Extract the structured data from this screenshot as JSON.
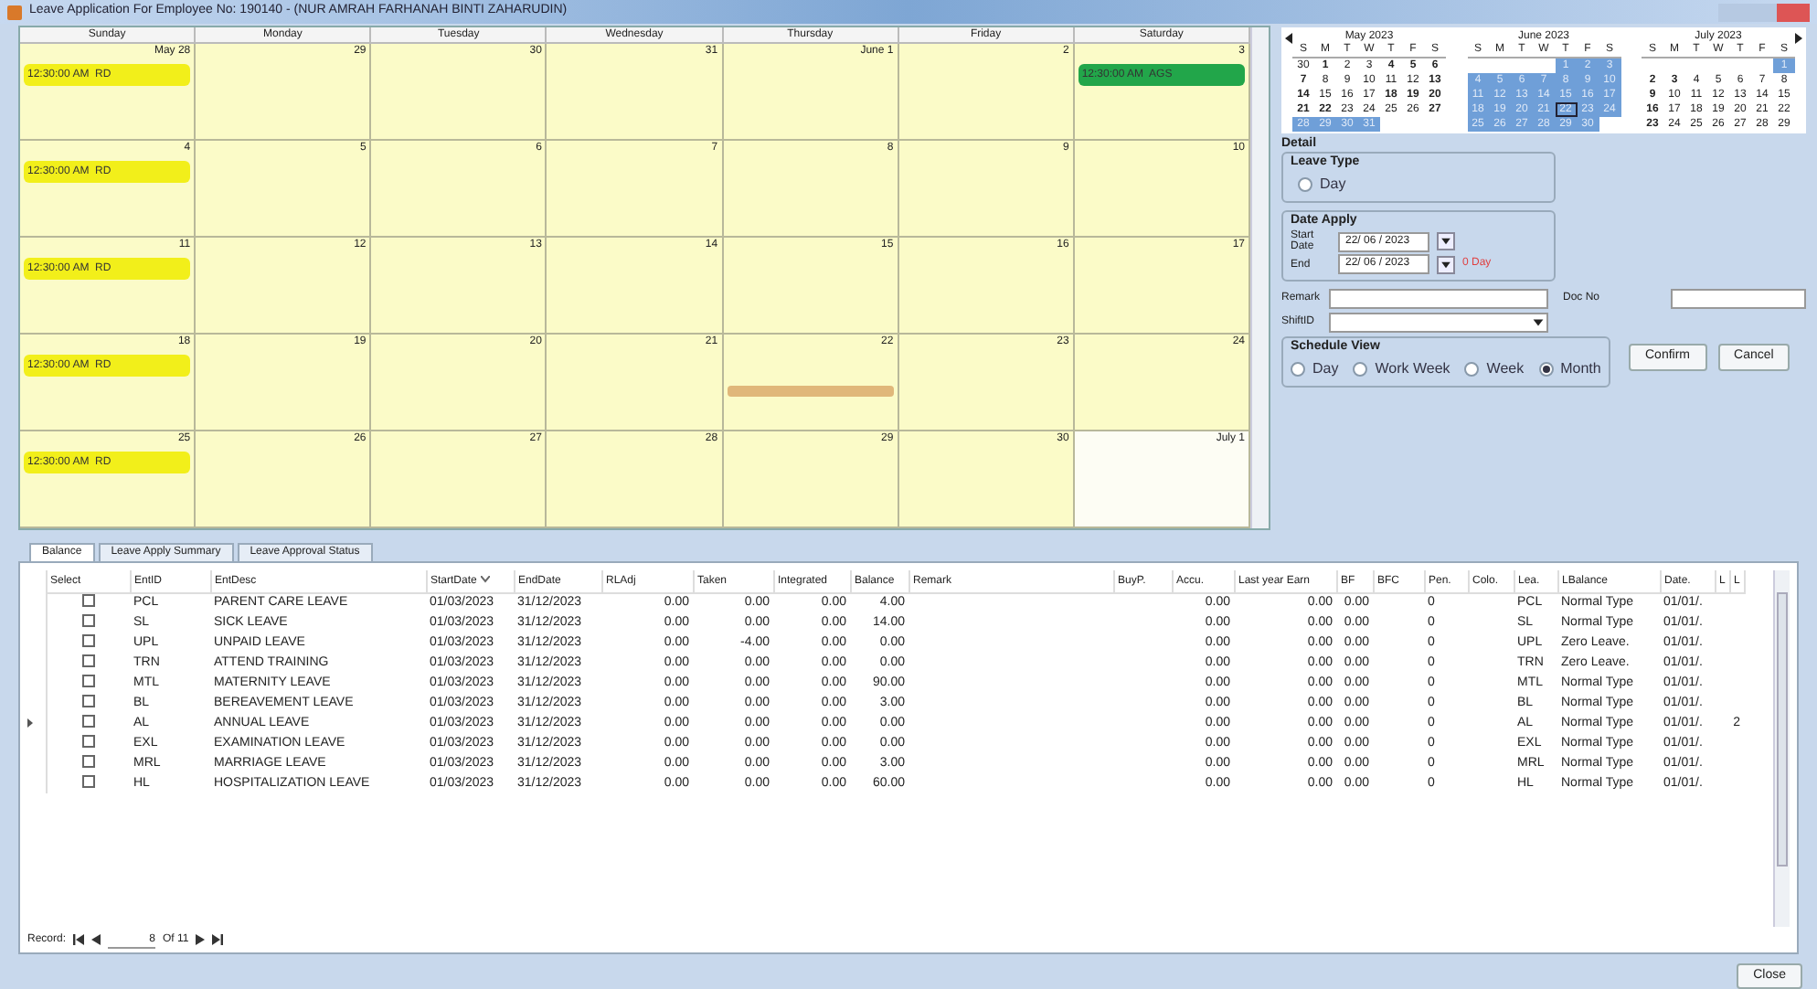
{
  "window": {
    "title": "Leave Application For Employee No: 190140 - (NUR AMRAH FARHANAH BINTI ZAHARUDIN)"
  },
  "schedule": {
    "weekdays": [
      "Sunday",
      "Monday",
      "Tuesday",
      "Wednesday",
      "Thursday",
      "Friday",
      "Saturday"
    ],
    "days": [
      {
        "label": "May 28",
        "shaded": true,
        "selected": false,
        "events": [
          {
            "text": "12:30:00 AM  RD",
            "color": "#f2ef1a"
          }
        ]
      },
      {
        "label": "29",
        "shaded": true,
        "selected": false
      },
      {
        "label": "30",
        "shaded": true,
        "selected": false
      },
      {
        "label": "31",
        "shaded": true,
        "selected": false
      },
      {
        "label": "June 1",
        "shaded": true,
        "selected": false
      },
      {
        "label": "2",
        "shaded": true,
        "selected": false
      },
      {
        "label": "3",
        "shaded": true,
        "selected": false,
        "events": [
          {
            "text": "12:30:00 AM  AGS",
            "color": "#22a64a"
          }
        ]
      },
      {
        "label": "4",
        "shaded": true,
        "selected": false,
        "events": [
          {
            "text": "12:30:00 AM  RD",
            "color": "#f2ef1a"
          }
        ]
      },
      {
        "label": "5",
        "shaded": true,
        "selected": false
      },
      {
        "label": "6",
        "shaded": true,
        "selected": false
      },
      {
        "label": "7",
        "shaded": true,
        "selected": false
      },
      {
        "label": "8",
        "shaded": true,
        "selected": false
      },
      {
        "label": "9",
        "shaded": true,
        "selected": false
      },
      {
        "label": "10",
        "shaded": true,
        "selected": false
      },
      {
        "label": "11",
        "shaded": true,
        "selected": false,
        "events": [
          {
            "text": "12:30:00 AM  RD",
            "color": "#f2ef1a"
          }
        ]
      },
      {
        "label": "12",
        "shaded": true,
        "selected": false
      },
      {
        "label": "13",
        "shaded": true,
        "selected": false
      },
      {
        "label": "14",
        "shaded": true,
        "selected": false
      },
      {
        "label": "15",
        "shaded": true,
        "selected": false
      },
      {
        "label": "16",
        "shaded": true,
        "selected": false
      },
      {
        "label": "17",
        "shaded": true,
        "selected": false
      },
      {
        "label": "18",
        "shaded": true,
        "selected": false,
        "events": [
          {
            "text": "12:30:00 AM  RD",
            "color": "#f2ef1a"
          }
        ]
      },
      {
        "label": "19",
        "shaded": true,
        "selected": false
      },
      {
        "label": "20",
        "shaded": true,
        "selected": false
      },
      {
        "label": "21",
        "shaded": true,
        "selected": false
      },
      {
        "label": "22",
        "shaded": true,
        "selected": true
      },
      {
        "label": "23",
        "shaded": true,
        "selected": false
      },
      {
        "label": "24",
        "shaded": true,
        "selected": false
      },
      {
        "label": "25",
        "shaded": true,
        "selected": false,
        "events": [
          {
            "text": "12:30:00 AM  RD",
            "color": "#f2ef1a"
          }
        ]
      },
      {
        "label": "26",
        "shaded": true,
        "selected": false
      },
      {
        "label": "27",
        "shaded": true,
        "selected": false
      },
      {
        "label": "28",
        "shaded": true,
        "selected": false
      },
      {
        "label": "29",
        "shaded": true,
        "selected": false
      },
      {
        "label": "30",
        "shaded": true,
        "selected": false
      },
      {
        "label": "July 1",
        "shaded": false,
        "selected": false
      }
    ]
  },
  "mini_calendars": [
    {
      "title": "May 2023",
      "weekdays": [
        "S",
        "M",
        "T",
        "W",
        "T",
        "F",
        "S"
      ],
      "weeks": [
        [
          {
            "d": "30",
            "bold": false,
            "selected": false
          },
          {
            "d": "1",
            "bold": true,
            "selected": false
          },
          {
            "d": "2",
            "bold": false,
            "selected": false
          },
          {
            "d": "3",
            "bold": false,
            "selected": false
          },
          {
            "d": "4",
            "bold": true,
            "selected": false
          },
          {
            "d": "5",
            "bold": true,
            "selected": false
          },
          {
            "d": "6",
            "bold": true,
            "selected": false
          }
        ],
        [
          {
            "d": "7",
            "bold": true,
            "selected": false
          },
          {
            "d": "8",
            "bold": false,
            "selected": false
          },
          {
            "d": "9",
            "bold": false,
            "selected": false
          },
          {
            "d": "10",
            "bold": false,
            "selected": false
          },
          {
            "d": "11",
            "bold": false,
            "selected": false
          },
          {
            "d": "12",
            "bold": false,
            "selected": false
          },
          {
            "d": "13",
            "bold": true,
            "selected": false
          }
        ],
        [
          {
            "d": "14",
            "bold": true,
            "selected": false
          },
          {
            "d": "15",
            "bold": false,
            "selected": false
          },
          {
            "d": "16",
            "bold": false,
            "selected": false
          },
          {
            "d": "17",
            "bold": false,
            "selected": false
          },
          {
            "d": "18",
            "bold": true,
            "selected": false
          },
          {
            "d": "19",
            "bold": true,
            "selected": false
          },
          {
            "d": "20",
            "bold": true,
            "selected": false
          }
        ],
        [
          {
            "d": "21",
            "bold": true,
            "selected": false
          },
          {
            "d": "22",
            "bold": true,
            "selected": false
          },
          {
            "d": "23",
            "bold": false,
            "selected": false
          },
          {
            "d": "24",
            "bold": false,
            "selected": false
          },
          {
            "d": "25",
            "bold": false,
            "selected": false
          },
          {
            "d": "26",
            "bold": false,
            "selected": false
          },
          {
            "d": "27",
            "bold": true,
            "selected": false
          }
        ],
        [
          {
            "d": "28",
            "bold": false,
            "selected": true
          },
          {
            "d": "29",
            "bold": false,
            "selected": true
          },
          {
            "d": "30",
            "bold": false,
            "selected": true
          },
          {
            "d": "31",
            "bold": false,
            "selected": true
          }
        ]
      ]
    },
    {
      "title": "June 2023",
      "weekdays": [
        "S",
        "M",
        "T",
        "W",
        "T",
        "F",
        "S"
      ],
      "weeks": [
        [
          {
            "d": "1",
            "bold": false,
            "selected": true
          },
          {
            "d": "2",
            "bold": false,
            "selected": true
          },
          {
            "d": "3",
            "bold": false,
            "selected": true
          }
        ],
        [
          {
            "d": "4",
            "bold": false,
            "selected": true
          },
          {
            "d": "5",
            "bold": false,
            "selected": true
          },
          {
            "d": "6",
            "bold": false,
            "selected": true
          },
          {
            "d": "7",
            "bold": false,
            "selected": true
          },
          {
            "d": "8",
            "bold": false,
            "selected": true
          },
          {
            "d": "9",
            "bold": false,
            "selected": true
          },
          {
            "d": "10",
            "bold": false,
            "selected": true
          }
        ],
        [
          {
            "d": "11",
            "bold": false,
            "selected": true
          },
          {
            "d": "12",
            "bold": false,
            "selected": true
          },
          {
            "d": "13",
            "bold": false,
            "selected": true
          },
          {
            "d": "14",
            "bold": false,
            "selected": true
          },
          {
            "d": "15",
            "bold": false,
            "selected": true
          },
          {
            "d": "16",
            "bold": false,
            "selected": true
          },
          {
            "d": "17",
            "bold": false,
            "selected": true
          }
        ],
        [
          {
            "d": "18",
            "bold": false,
            "selected": true
          },
          {
            "d": "19",
            "bold": false,
            "selected": true
          },
          {
            "d": "20",
            "bold": false,
            "selected": true
          },
          {
            "d": "21",
            "bold": false,
            "selected": true
          },
          {
            "d": "22",
            "bold": false,
            "selected": true,
            "today": true
          },
          {
            "d": "23",
            "bold": false,
            "selected": true
          },
          {
            "d": "24",
            "bold": false,
            "selected": true
          }
        ],
        [
          {
            "d": "25",
            "bold": false,
            "selected": true
          },
          {
            "d": "26",
            "bold": false,
            "selected": true
          },
          {
            "d": "27",
            "bold": false,
            "selected": true
          },
          {
            "d": "28",
            "bold": false,
            "selected": true
          },
          {
            "d": "29",
            "bold": false,
            "selected": true
          },
          {
            "d": "30",
            "bold": false,
            "selected": true
          }
        ]
      ]
    },
    {
      "title": "July 2023",
      "weekdays": [
        "S",
        "M",
        "T",
        "W",
        "T",
        "F",
        "S"
      ],
      "weeks": [
        [
          {
            "d": "1",
            "bold": false,
            "selected": true
          }
        ],
        [
          {
            "d": "2",
            "bold": true,
            "selected": false
          },
          {
            "d": "3",
            "bold": true,
            "selected": false
          },
          {
            "d": "4",
            "bold": false,
            "selected": false
          },
          {
            "d": "5",
            "bold": false,
            "selected": false
          },
          {
            "d": "6",
            "bold": false,
            "selected": false
          },
          {
            "d": "7",
            "bold": false,
            "selected": false
          },
          {
            "d": "8",
            "bold": false,
            "selected": false
          }
        ],
        [
          {
            "d": "9",
            "bold": true,
            "selected": false
          },
          {
            "d": "10",
            "bold": false,
            "selected": false
          },
          {
            "d": "11",
            "bold": false,
            "selected": false
          },
          {
            "d": "12",
            "bold": false,
            "selected": false
          },
          {
            "d": "13",
            "bold": false,
            "selected": false
          },
          {
            "d": "14",
            "bold": false,
            "selected": false
          },
          {
            "d": "15",
            "bold": false,
            "selected": false
          }
        ],
        [
          {
            "d": "16",
            "bold": true,
            "selected": false
          },
          {
            "d": "17",
            "bold": false,
            "selected": false
          },
          {
            "d": "18",
            "bold": false,
            "selected": false
          },
          {
            "d": "19",
            "bold": false,
            "selected": false
          },
          {
            "d": "20",
            "bold": false,
            "selected": false
          },
          {
            "d": "21",
            "bold": false,
            "selected": false
          },
          {
            "d": "22",
            "bold": false,
            "selected": false
          }
        ],
        [
          {
            "d": "23",
            "bold": true,
            "selected": false
          },
          {
            "d": "24",
            "bold": false,
            "selected": false
          },
          {
            "d": "25",
            "bold": false,
            "selected": false
          },
          {
            "d": "26",
            "bold": false,
            "selected": false
          },
          {
            "d": "27",
            "bold": false,
            "selected": false
          },
          {
            "d": "28",
            "bold": false,
            "selected": false
          },
          {
            "d": "29",
            "bold": false,
            "selected": false
          }
        ]
      ]
    }
  ],
  "detail": {
    "title": "Detail",
    "leave_type": {
      "title": "Leave Type",
      "options": [
        {
          "label": "Day",
          "selected": false
        }
      ]
    },
    "date_apply": {
      "title": "Date Apply",
      "start_label": "Start Date",
      "start_value": "22/ 06 / 2023",
      "end_label": "End",
      "end_value": "22/ 06 / 2023",
      "duration": "0 Day"
    },
    "remark_label": "Remark",
    "doc_no_label": "Doc No",
    "shift_label": "ShiftID",
    "schedule_view": {
      "title": "Schedule View",
      "options": [
        {
          "label": "Day",
          "selected": false
        },
        {
          "label": "Work Week",
          "selected": false
        },
        {
          "label": "Week",
          "selected": false
        },
        {
          "label": "Month",
          "selected": true
        }
      ]
    },
    "buttons": [
      "Confirm",
      "Cancel"
    ]
  },
  "tabs": [
    {
      "label": "Balance",
      "selected": true
    },
    {
      "label": "Leave Apply Summary",
      "selected": false
    },
    {
      "label": "Leave Approval Status",
      "selected": false
    }
  ],
  "table": {
    "columns": [
      "Select",
      "EntID",
      "EntDesc",
      "StartDate",
      "EndDate",
      "RLAdj",
      "Taken",
      "Integrated",
      "Balance",
      "Remark",
      "BuyP.",
      "Accu.",
      "Last year Earn",
      "BF",
      "BFC",
      "Pen.",
      "Colo.",
      "Lea.",
      "LBalance",
      "Date.",
      "L",
      "L"
    ],
    "rows": [
      {
        "current": false,
        "checked": false,
        "ent_id": "PCL",
        "ent_desc": "PARENT CARE LEAVE",
        "start_date": "01/03/2023",
        "end_date": "31/12/2023",
        "rl_adj": "0.00",
        "taken": "0.00",
        "integrated": "0.00",
        "balance": "4.00",
        "accu": "0.00",
        "last_year_earn": "0.00",
        "bf": "0.00",
        "pen": "0",
        "lea": "PCL",
        "l_balance": "Normal Type",
        "date": "01/01/."
      },
      {
        "current": false,
        "checked": false,
        "ent_id": "SL",
        "ent_desc": "SICK LEAVE",
        "start_date": "01/03/2023",
        "end_date": "31/12/2023",
        "rl_adj": "0.00",
        "taken": "0.00",
        "integrated": "0.00",
        "balance": "14.00",
        "accu": "0.00",
        "last_year_earn": "0.00",
        "bf": "0.00",
        "pen": "0",
        "lea": "SL",
        "l_balance": "Normal Type",
        "date": "01/01/."
      },
      {
        "current": false,
        "checked": false,
        "ent_id": "UPL",
        "ent_desc": "UNPAID LEAVE",
        "start_date": "01/03/2023",
        "end_date": "31/12/2023",
        "rl_adj": "0.00",
        "taken": "-4.00",
        "integrated": "0.00",
        "balance": "0.00",
        "accu": "0.00",
        "last_year_earn": "0.00",
        "bf": "0.00",
        "pen": "0",
        "lea": "UPL",
        "l_balance": "Zero Leave.",
        "date": "01/01/."
      },
      {
        "current": false,
        "checked": false,
        "ent_id": "TRN",
        "ent_desc": "ATTEND TRAINING",
        "start_date": "01/03/2023",
        "end_date": "31/12/2023",
        "rl_adj": "0.00",
        "taken": "0.00",
        "integrated": "0.00",
        "balance": "0.00",
        "accu": "0.00",
        "last_year_earn": "0.00",
        "bf": "0.00",
        "pen": "0",
        "lea": "TRN",
        "l_balance": "Zero Leave.",
        "date": "01/01/."
      },
      {
        "current": false,
        "checked": false,
        "ent_id": "MTL",
        "ent_desc": "MATERNITY LEAVE",
        "start_date": "01/03/2023",
        "end_date": "31/12/2023",
        "rl_adj": "0.00",
        "taken": "0.00",
        "integrated": "0.00",
        "balance": "90.00",
        "accu": "0.00",
        "last_year_earn": "0.00",
        "bf": "0.00",
        "pen": "0",
        "lea": "MTL",
        "l_balance": "Normal Type",
        "date": "01/01/."
      },
      {
        "current": false,
        "checked": false,
        "ent_id": "BL",
        "ent_desc": "BEREAVEMENT LEAVE",
        "start_date": "01/03/2023",
        "end_date": "31/12/2023",
        "rl_adj": "0.00",
        "taken": "0.00",
        "integrated": "0.00",
        "balance": "3.00",
        "accu": "0.00",
        "last_year_earn": "0.00",
        "bf": "0.00",
        "pen": "0",
        "lea": "BL",
        "l_balance": "Normal Type",
        "date": "01/01/."
      },
      {
        "current": true,
        "checked": false,
        "ent_id": "AL",
        "ent_desc": "ANNUAL LEAVE",
        "start_date": "01/03/2023",
        "end_date": "31/12/2023",
        "rl_adj": "0.00",
        "taken": "0.00",
        "integrated": "0.00",
        "balance": "0.00",
        "accu": "0.00",
        "last_year_earn": "0.00",
        "bf": "0.00",
        "pen": "0",
        "lea": "AL",
        "l_balance": "Normal Type",
        "date": "01/01/.",
        "l_2": "2"
      },
      {
        "current": false,
        "checked": false,
        "ent_id": "EXL",
        "ent_desc": "EXAMINATION LEAVE",
        "start_date": "01/03/2023",
        "end_date": "31/12/2023",
        "rl_adj": "0.00",
        "taken": "0.00",
        "integrated": "0.00",
        "balance": "0.00",
        "accu": "0.00",
        "last_year_earn": "0.00",
        "bf": "0.00",
        "pen": "0",
        "lea": "EXL",
        "l_balance": "Normal Type",
        "date": "01/01/."
      },
      {
        "current": false,
        "checked": false,
        "ent_id": "MRL",
        "ent_desc": "MARRIAGE LEAVE",
        "start_date": "01/03/2023",
        "end_date": "31/12/2023",
        "rl_adj": "0.00",
        "taken": "0.00",
        "integrated": "0.00",
        "balance": "3.00",
        "accu": "0.00",
        "last_year_earn": "0.00",
        "bf": "0.00",
        "pen": "0",
        "lea": "MRL",
        "l_balance": "Normal Type",
        "date": "01/01/."
      },
      {
        "current": false,
        "checked": false,
        "ent_id": "HL",
        "ent_desc": "HOSPITALIZATION LEAVE",
        "start_date": "01/03/2023",
        "end_date": "31/12/2023",
        "rl_adj": "0.00",
        "taken": "0.00",
        "integrated": "0.00",
        "balance": "60.00",
        "accu": "0.00",
        "last_year_earn": "0.00",
        "bf": "0.00",
        "pen": "0",
        "lea": "HL",
        "l_balance": "Normal Type",
        "date": "01/01/."
      }
    ]
  },
  "record_nav": {
    "label": "Record:",
    "current": "8",
    "total": "Of 11"
  },
  "close_button": "Close"
}
